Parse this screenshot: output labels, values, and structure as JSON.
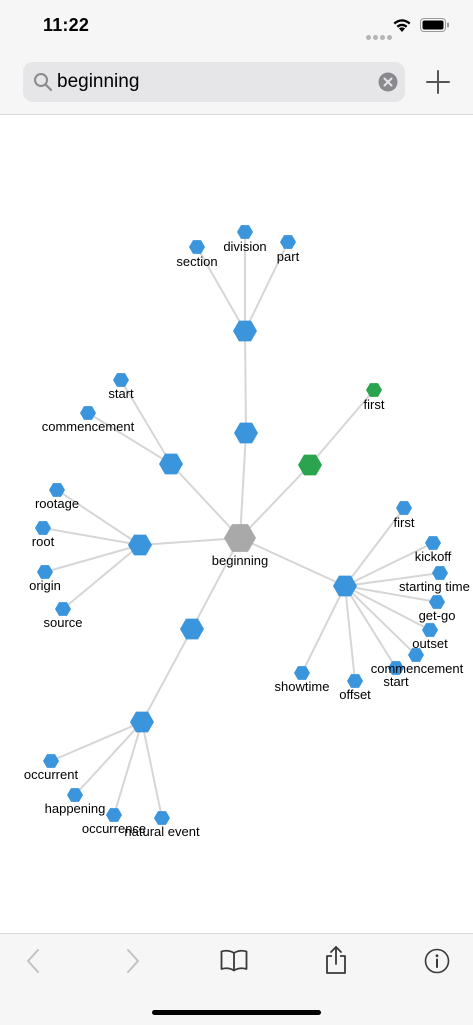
{
  "status_bar": {
    "time": "11:22"
  },
  "search": {
    "value": "beginning"
  },
  "graph": {
    "center": "beginning",
    "colors": {
      "node": "#3a95dd",
      "center": "#a9a9a9",
      "highlight": "#2aa44f",
      "edge": "#d6d6d6"
    },
    "labels": {
      "center": "beginning",
      "section": "section",
      "division": "division",
      "part": "part",
      "start_top": "start",
      "commencement_left": "commencement",
      "first_green": "first",
      "rootage": "rootage",
      "root": "root",
      "origin": "origin",
      "source": "source",
      "first_right": "first",
      "kickoff": "kickoff",
      "starting_time": "starting time",
      "get_go": "get-go",
      "outset": "outset",
      "commencement_right": "commencement",
      "start_right": "start",
      "offset": "offset",
      "showtime": "showtime",
      "occurrent": "occurrent",
      "happening": "happening",
      "occurrence": "occurrence",
      "natural_event": "natural event"
    }
  },
  "toolbar": {
    "items": [
      "back",
      "forward",
      "bookmarks",
      "share",
      "info"
    ]
  }
}
